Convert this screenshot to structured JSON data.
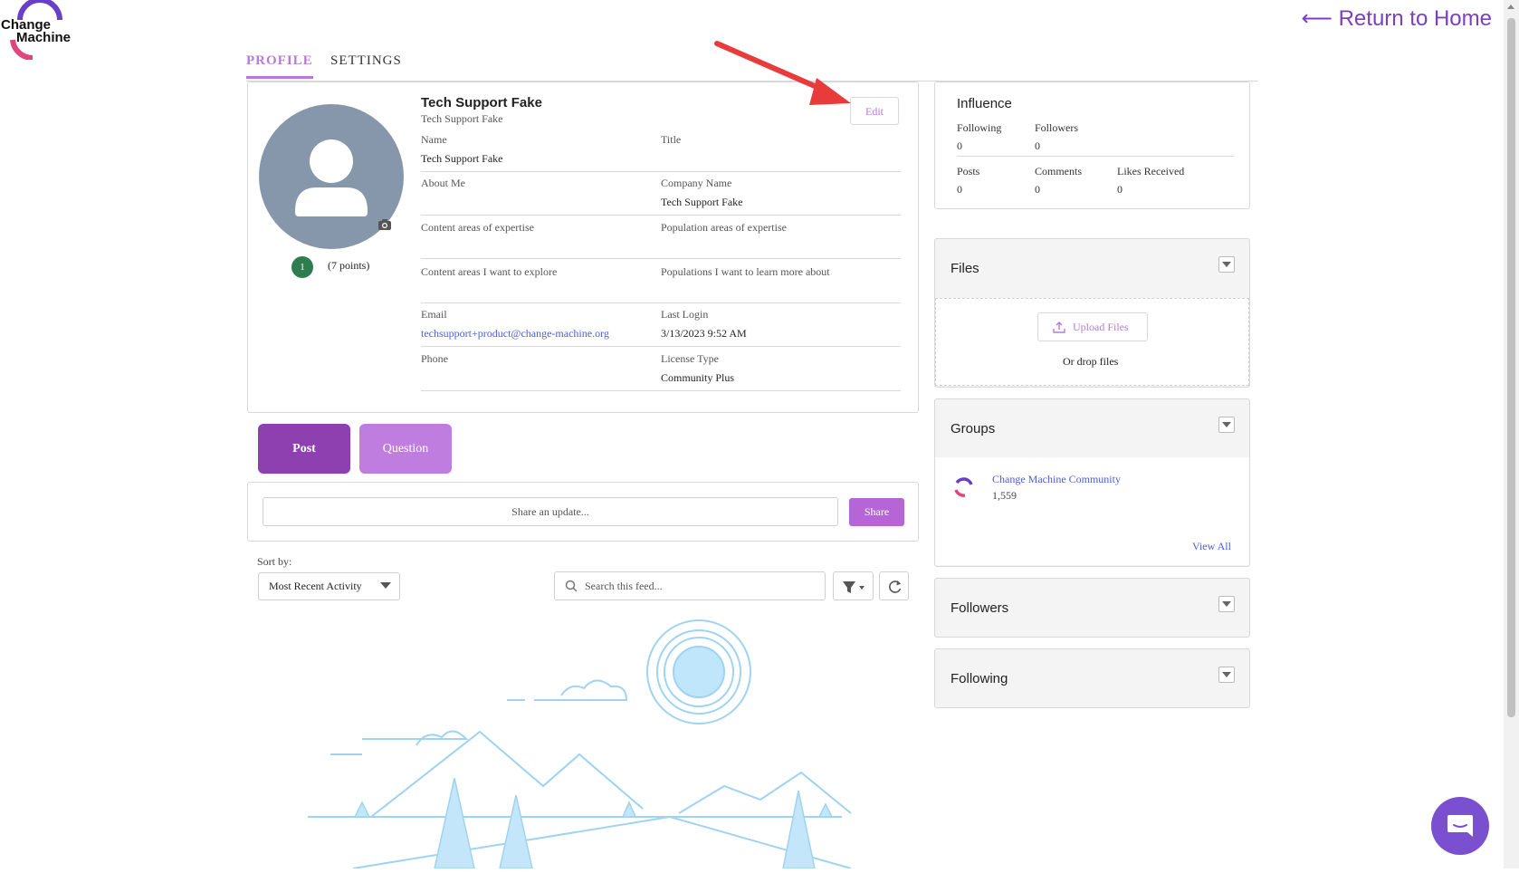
{
  "header": {
    "logo_text_line1": "Change",
    "logo_text_line2": "Machine",
    "return_home": "⟵ Return to Home"
  },
  "tabs": [
    {
      "label": "PROFILE",
      "active": true
    },
    {
      "label": "SETTINGS",
      "active": false
    }
  ],
  "profile": {
    "name": "Tech Support Fake",
    "subname": "Tech Support Fake",
    "edit_label": "Edit",
    "level": "1",
    "points": "(7 points)",
    "fields": {
      "name_label": "Name",
      "name_value": "Tech Support Fake",
      "title_label": "Title",
      "title_value": "",
      "about_label": "About Me",
      "about_value": "",
      "company_label": "Company Name",
      "company_value": "Tech Support Fake",
      "content_expertise_label": "Content areas of expertise",
      "population_expertise_label": "Population areas of expertise",
      "content_explore_label": "Content areas I want to explore",
      "population_learn_label": "Populations I want to learn more about",
      "email_label": "Email",
      "email_value": "techsupport+product@change-machine.org",
      "last_login_label": "Last Login",
      "last_login_value": "3/13/2023 9:52 AM",
      "phone_label": "Phone",
      "phone_value": "",
      "license_label": "License Type",
      "license_value": "Community Plus"
    }
  },
  "composer": {
    "post_label": "Post",
    "question_label": "Question",
    "share_placeholder": "Share an update...",
    "share_label": "Share"
  },
  "feed": {
    "sort_label": "Sort by:",
    "sort_value": "Most Recent Activity",
    "search_placeholder": "Search this feed..."
  },
  "influence": {
    "title": "Influence",
    "following_label": "Following",
    "following_value": "0",
    "followers_label": "Followers",
    "followers_value": "0",
    "posts_label": "Posts",
    "posts_value": "0",
    "comments_label": "Comments",
    "comments_value": "0",
    "likes_label": "Likes Received",
    "likes_value": "0"
  },
  "files": {
    "title": "Files",
    "upload_label": "Upload Files",
    "drop_text": "Or drop files"
  },
  "groups": {
    "title": "Groups",
    "items": [
      {
        "name": "Change Machine Community",
        "members": "1,559"
      }
    ],
    "view_all": "View All"
  },
  "followers_panel": {
    "title": "Followers"
  },
  "following_panel": {
    "title": "Following"
  },
  "colors": {
    "accent": "#b87ad9",
    "post_button": "#8e3fb0",
    "question_button": "#c07de0",
    "link": "#4a5fd3",
    "chat": "#7a4fd0",
    "avatar_bg": "#8797ab",
    "level_badge": "#2e7d4f"
  },
  "icons": [
    "logo-icon",
    "camera-icon",
    "search-icon",
    "filter-icon",
    "refresh-icon",
    "upload-icon",
    "chevron-down-icon",
    "chat-icon",
    "annotation-arrow-icon"
  ]
}
